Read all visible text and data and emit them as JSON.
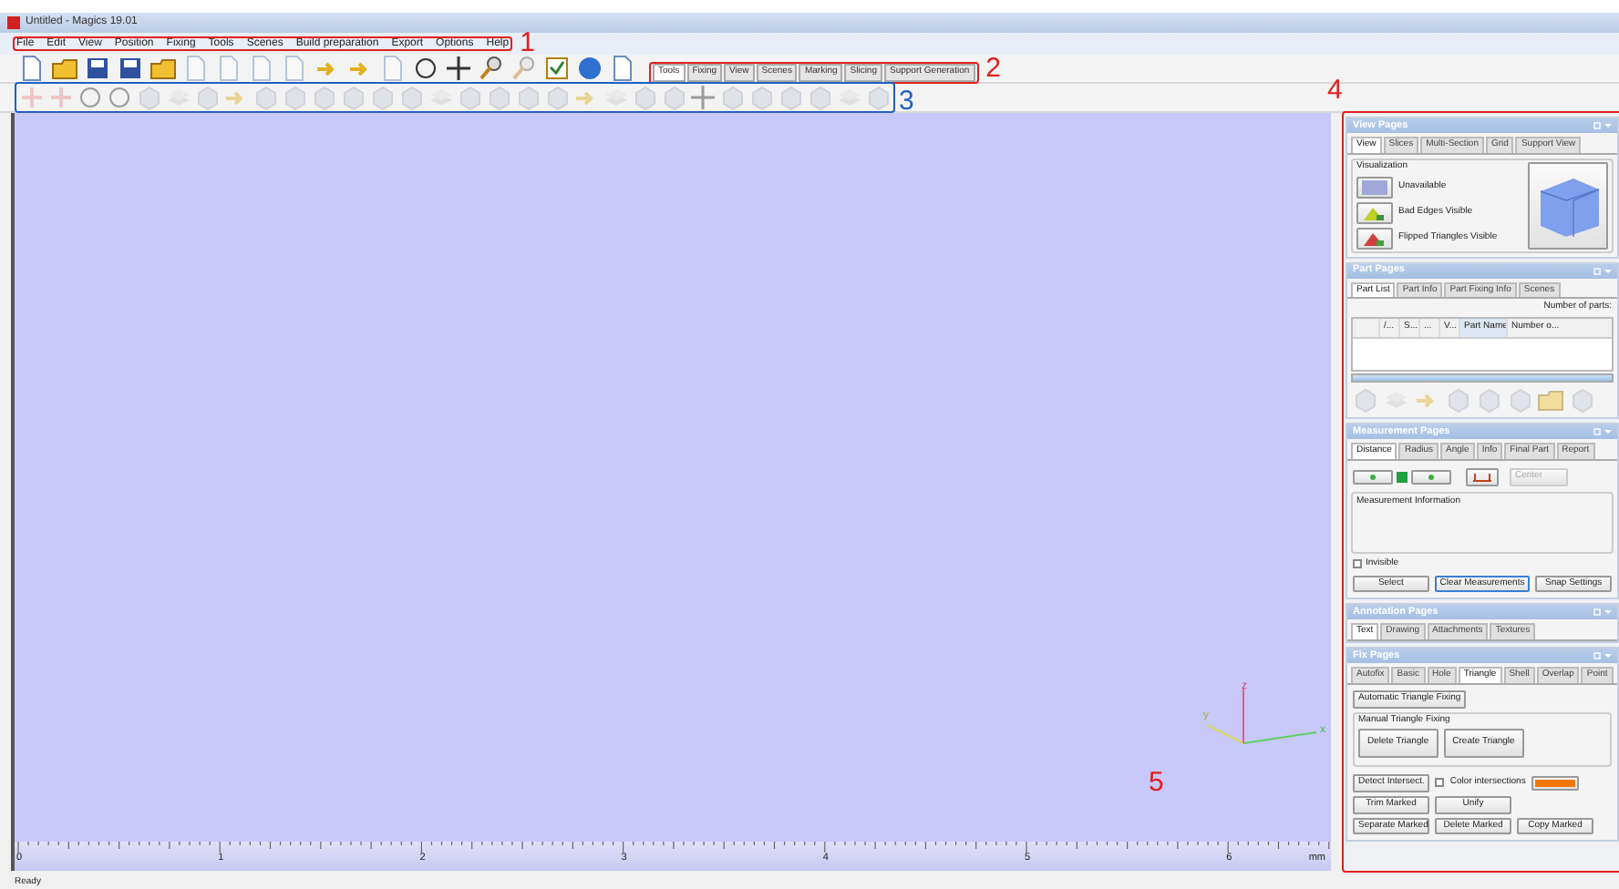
{
  "window": {
    "title": "Untitled - Magics 19.01"
  },
  "menu": [
    "File",
    "Edit",
    "View",
    "Position",
    "Fixing",
    "Tools",
    "Scenes",
    "Build preparation",
    "Export",
    "Options",
    "Help"
  ],
  "toolbar_tabs": [
    {
      "label": "Tools",
      "selected": true
    },
    {
      "label": "Fixing",
      "selected": false
    },
    {
      "label": "View",
      "selected": false
    },
    {
      "label": "Scenes",
      "selected": false
    },
    {
      "label": "Marking",
      "selected": false
    },
    {
      "label": "Slicing",
      "selected": false
    },
    {
      "label": "Support Generation",
      "selected": false
    }
  ],
  "viewport": {
    "axis_labels": [
      "x",
      "y",
      "z"
    ],
    "ruler": {
      "labels": [
        "0",
        "1",
        "2",
        "3",
        "4",
        "5",
        "6"
      ],
      "unit": "mm"
    }
  },
  "view_pages": {
    "title": "View Pages",
    "tabs": [
      {
        "label": "View",
        "selected": true
      },
      {
        "label": "Slices",
        "selected": false
      },
      {
        "label": "Multi-Section",
        "selected": false
      },
      {
        "label": "Grid",
        "selected": false
      },
      {
        "label": "Support View",
        "selected": false
      }
    ],
    "group": "Visualization",
    "options": [
      "Unavailable",
      "Bad Edges Visible",
      "Flipped Triangles Visible"
    ]
  },
  "part_pages": {
    "title": "Part Pages",
    "tabs": [
      {
        "label": "Part List",
        "selected": true
      },
      {
        "label": "Part Info",
        "selected": false
      },
      {
        "label": "Part Fixing Info",
        "selected": false
      },
      {
        "label": "Scenes",
        "selected": false
      }
    ],
    "count_label": "Number of parts:",
    "columns": [
      "/...",
      "S...",
      "...",
      "V...",
      "Part Name",
      "Number o..."
    ]
  },
  "measurement_pages": {
    "title": "Measurement Pages",
    "tabs": [
      {
        "label": "Distance",
        "selected": true
      },
      {
        "label": "Radius",
        "selected": false
      },
      {
        "label": "Angle",
        "selected": false
      },
      {
        "label": "Info",
        "selected": false
      },
      {
        "label": "Final Part",
        "selected": false
      },
      {
        "label": "Report",
        "selected": false
      }
    ],
    "mode": {
      "value": "Center",
      "disabled": true
    },
    "group": "Measurement Information",
    "invisible": {
      "label": "Invisible",
      "checked": false
    },
    "buttons": [
      {
        "label": "Select",
        "focused": false
      },
      {
        "label": "Clear Measurements",
        "focused": true
      },
      {
        "label": "Snap Settings",
        "focused": false
      }
    ]
  },
  "annotation_pages": {
    "title": "Annotation Pages",
    "tabs": [
      {
        "label": "Text",
        "selected": true
      },
      {
        "label": "Drawing",
        "selected": false
      },
      {
        "label": "Attachments",
        "selected": false
      },
      {
        "label": "Textures",
        "selected": false
      }
    ]
  },
  "fix_pages": {
    "title": "Fix Pages",
    "tabs": [
      {
        "label": "Autofix",
        "selected": false
      },
      {
        "label": "Basic",
        "selected": false
      },
      {
        "label": "Hole",
        "selected": false
      },
      {
        "label": "Triangle",
        "selected": true
      },
      {
        "label": "Shell",
        "selected": false
      },
      {
        "label": "Overlap",
        "selected": false
      },
      {
        "label": "Point",
        "selected": false
      }
    ],
    "auto_button": "Automatic Triangle Fixing",
    "group": "Manual Triangle Fixing",
    "big_buttons": [
      "Delete Triangle",
      "Create Triangle"
    ],
    "detect_button": "Detect Intersect.",
    "color_intersections": {
      "label": "Color intersections",
      "checked": false,
      "color": "#f07800"
    },
    "buttons": [
      [
        "Trim Marked",
        "Unify"
      ],
      [
        "Separate Marked",
        "Delete Marked",
        "Copy Marked"
      ]
    ]
  },
  "status_bar": "Ready",
  "annotations": [
    {
      "label": "1",
      "color": "#e02020"
    },
    {
      "label": "2",
      "color": "#e02020"
    },
    {
      "label": "3",
      "color": "#2060c0"
    },
    {
      "label": "4",
      "color": "#e02020"
    },
    {
      "label": "5",
      "color": "#e02020"
    }
  ]
}
